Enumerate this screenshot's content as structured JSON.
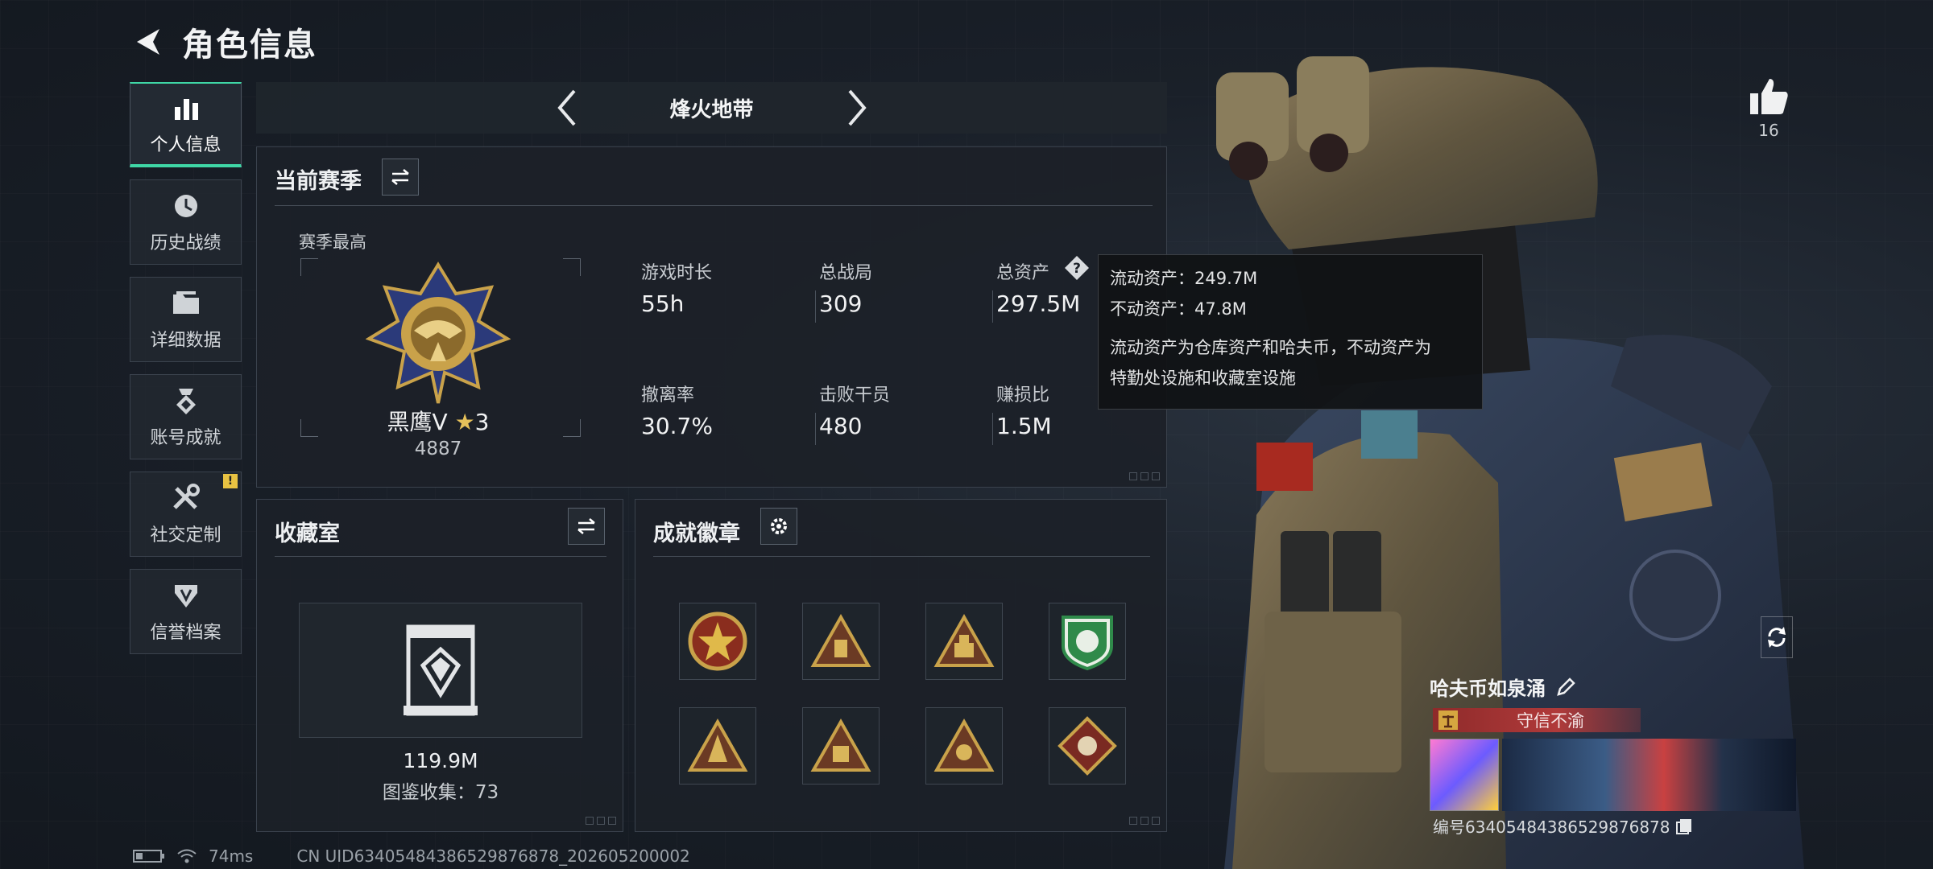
{
  "header": {
    "title": "角色信息"
  },
  "nav": {
    "items": [
      {
        "label": "个人信息",
        "icon": "bar-chart-icon",
        "active": true
      },
      {
        "label": "历史战绩",
        "icon": "clock-icon",
        "active": false
      },
      {
        "label": "详细数据",
        "icon": "folder-icon",
        "active": false
      },
      {
        "label": "账号成就",
        "icon": "medal-icon",
        "active": false
      },
      {
        "label": "社交定制",
        "icon": "tools-icon",
        "active": false,
        "badge": "!"
      },
      {
        "label": "信誉档案",
        "icon": "shield-icon",
        "active": false
      }
    ]
  },
  "mode": {
    "name": "烽火地带"
  },
  "season": {
    "title": "当前赛季",
    "best_label": "赛季最高",
    "rank_name": "黑鹰Ⅴ",
    "rank_stars": "3",
    "rank_score": "4887",
    "stats": [
      {
        "label": "游戏时长",
        "value": "55h"
      },
      {
        "label": "总战局",
        "value": "309"
      },
      {
        "label": "总资产",
        "value": "297.5M"
      },
      {
        "label": "撤离率",
        "value": "30.7%"
      },
      {
        "label": "击败干员",
        "value": "480"
      },
      {
        "label": "赚损比",
        "value": "1.5M"
      }
    ]
  },
  "tooltip": {
    "line1": "流动资产：249.7M",
    "line2": "不动资产：47.8M",
    "line3": "流动资产为仓库资产和哈夫币，不动资产为",
    "line4": "特勤处设施和收藏室设施"
  },
  "collection": {
    "title": "收藏室",
    "value": "119.9M",
    "count_text": "图鉴收集：73"
  },
  "achievements": {
    "title": "成就徽章",
    "badges": [
      "star-medal",
      "triangle-badge",
      "triangle-badge",
      "shield-badge",
      "triangle-badge",
      "triangle-badge",
      "triangle-badge",
      "diamond-badge"
    ]
  },
  "profile": {
    "likes": "16",
    "name": "哈夫币如泉涌",
    "credit_tag": "守信不渝",
    "id_text": "编号634054843865298768​78"
  },
  "status": {
    "ping": "74ms",
    "uid": "CN UID6340548438652987687​8_202605200002"
  },
  "colors": {
    "accent": "#3fd7a6",
    "warning": "#e8c242",
    "credit_red": "#8e2a2a",
    "rank_gold": "#c9a24a"
  }
}
